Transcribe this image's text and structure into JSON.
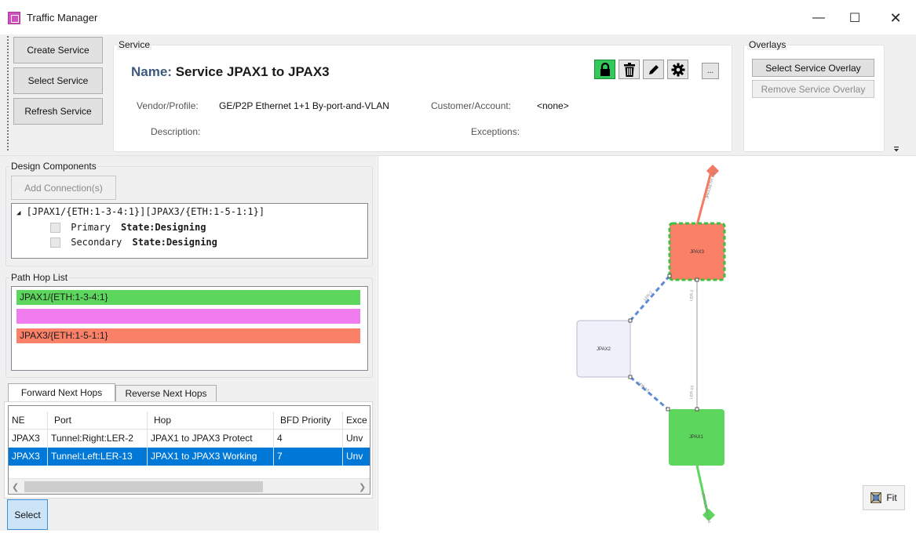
{
  "window": {
    "title": "Traffic Manager",
    "minimize_glyph": "—",
    "maximize_glyph": "☐",
    "close_glyph": "✕"
  },
  "toolbar": {
    "create_service": "Create Service",
    "select_service": "Select Service",
    "refresh_service": "Refresh Service"
  },
  "service": {
    "group_label": "Service",
    "name_label": "Name:",
    "name_value": "Service JPAX1 to JPAX3",
    "vendor_label": "Vendor/Profile:",
    "vendor_value": "GE/P2P Ethernet 1+1 By-port-and-VLAN",
    "customer_label": "Customer/Account:",
    "customer_value": "<none>",
    "description_label": "Description:",
    "exceptions_label": "Exceptions:",
    "more_label": "...",
    "icons": [
      "lock-icon",
      "trash-icon",
      "pencil-icon",
      "gear-icon"
    ],
    "lock_color": "#34c85a"
  },
  "overlays": {
    "group_label": "Overlays",
    "select_overlay": "Select Service Overlay",
    "remove_overlay": "Remove Service Overlay"
  },
  "design_components": {
    "label": "Design Components",
    "add_connection": "Add Connection(s)",
    "tree_root": "[JPAX1/{ETH:1-3-4:1}][JPAX3/{ETH:1-5-1:1}]",
    "items": [
      {
        "name": "Primary",
        "state": "State:Designing"
      },
      {
        "name": "Secondary",
        "state": "State:Designing"
      }
    ]
  },
  "path_hop_list": {
    "label": "Path Hop List",
    "hops": [
      {
        "text": "JPAX1/{ETH:1-3-4:1}",
        "color": "#5cd65c"
      },
      {
        "text": "",
        "color": "#f07cf0"
      },
      {
        "text": "JPAX3/{ETH:1-5-1:1}",
        "color": "#fa8068"
      }
    ]
  },
  "tabs": {
    "forward": "Forward Next Hops",
    "reverse": "Reverse Next Hops"
  },
  "grid": {
    "columns": [
      "NE",
      "Port",
      "Hop",
      "BFD Priority",
      "Exce"
    ],
    "rows": [
      {
        "ne": "JPAX3",
        "port": "Tunnel:Right:LER-2",
        "hop": "JPAX1 to JPAX3 Protect",
        "bfd": "4",
        "exc": "Unv"
      },
      {
        "ne": "JPAX3",
        "port": "Tunnel:Left:LER-13",
        "hop": "JPAX1 to JPAX3 Working",
        "bfd": "7",
        "exc": "Unv"
      }
    ]
  },
  "select_button": "Select",
  "topology": {
    "nodes": [
      {
        "id": "JPAX3",
        "label": "JPAX3",
        "color": "#fa8068"
      },
      {
        "id": "JPAX2",
        "label": "JPAX2",
        "color": "#f0f0fa"
      },
      {
        "id": "JPAX1",
        "label": "JPAX1",
        "color": "#5cd65c"
      }
    ],
    "fit_label": "Fit"
  }
}
